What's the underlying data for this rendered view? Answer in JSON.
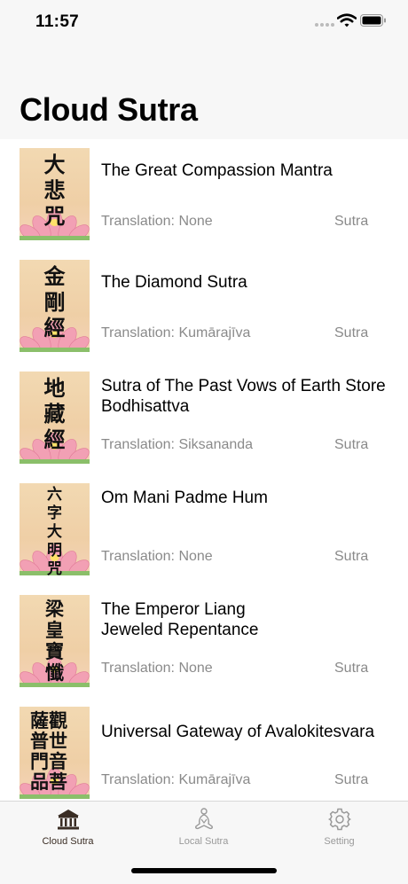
{
  "status_bar": {
    "time": "11:57"
  },
  "header": {
    "title": "Cloud Sutra"
  },
  "sutras": [
    {
      "thumb_chars": "大\n悲\n咒",
      "title": "The Great Compassion Mantra",
      "translation": "Translation: None",
      "category": "Sutra"
    },
    {
      "thumb_chars": "金\n剛\n經",
      "title": "The Diamond Sutra",
      "translation": "Translation: Kumārajīva",
      "category": "Sutra"
    },
    {
      "thumb_chars": "地\n藏\n經",
      "title": "Sutra of The Past Vows of Earth Store Bodhisattva",
      "translation": "Translation: Siksananda",
      "category": "Sutra"
    },
    {
      "thumb_chars": "六\n字\n大\n明\n咒",
      "title": "Om Mani Padme Hum",
      "translation": "Translation: None",
      "category": "Sutra"
    },
    {
      "thumb_chars": "梁\n皇\n寶\n懺",
      "title": "The Emperor Liang\nJeweled Repentance",
      "translation": "Translation: None",
      "category": "Sutra"
    },
    {
      "thumb_chars": "薩觀\n普世\n門音\n品菩",
      "title": "Universal Gateway of Avalokitesvara",
      "translation": "Translation: Kumārajīva",
      "category": "Sutra"
    }
  ],
  "tabs": [
    {
      "label": "Cloud Sutra",
      "icon": "temple-icon",
      "active": true
    },
    {
      "label": "Local Sutra",
      "icon": "meditation-icon",
      "active": false
    },
    {
      "label": "Setting",
      "icon": "gear-icon",
      "active": false
    }
  ],
  "colors": {
    "active_tab": "#3a2d24",
    "inactive_tab": "#999999",
    "secondary_text": "#8a8a8a"
  }
}
